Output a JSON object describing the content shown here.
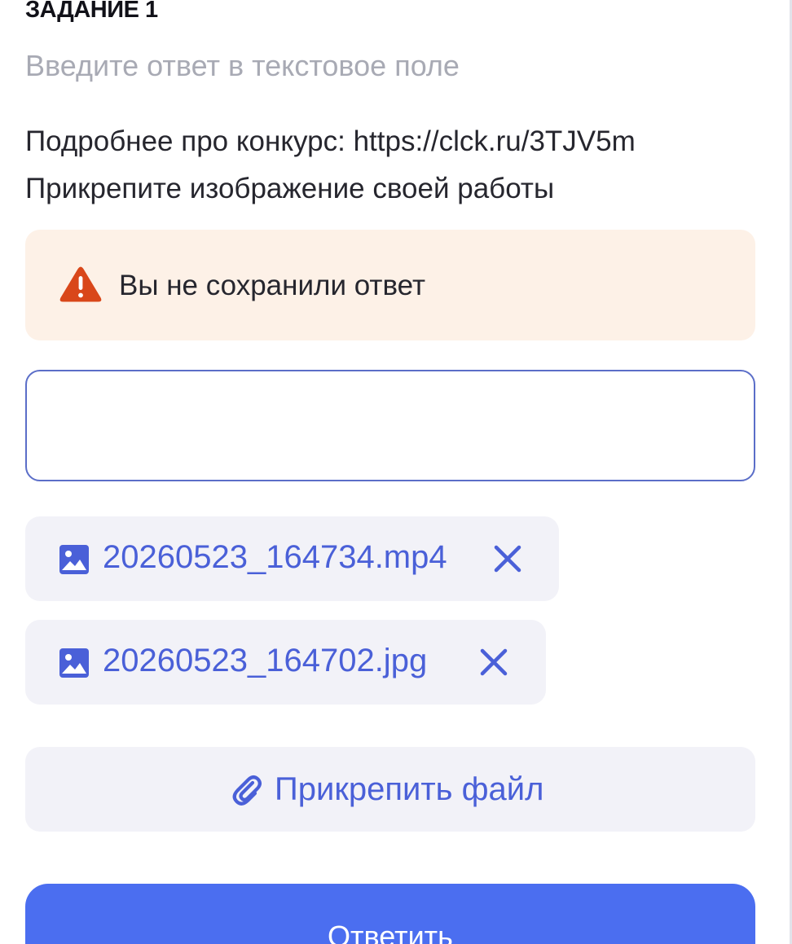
{
  "task": {
    "title": "ЗАДАНИЕ 1",
    "subtitle": "Введите ответ в текстовое поле",
    "description_line1": "Подробнее про конкурс: https://clck.ru/3TJV5m",
    "description_line2": "Прикрепите изображение своей работы"
  },
  "alert": {
    "icon": "warning-triangle-icon",
    "text": "Вы не сохранили ответ",
    "color": "#d9471a"
  },
  "answer": {
    "value": "",
    "placeholder": ""
  },
  "attachments": [
    {
      "name": "20260523_164734.mp4",
      "icon": "image-icon",
      "remove_icon": "close-icon"
    },
    {
      "name": "20260523_164702.jpg",
      "icon": "image-icon",
      "remove_icon": "close-icon"
    }
  ],
  "attach_button": {
    "label": "Прикрепить файл",
    "icon": "paperclip-icon"
  },
  "submit_button": {
    "label": "Ответить"
  },
  "colors": {
    "accent": "#4a60d8",
    "primary_button": "#4b6ef0",
    "alert_background": "#fdf1e7",
    "chip_background": "#f2f2f8",
    "muted_text": "#a8aab4"
  }
}
